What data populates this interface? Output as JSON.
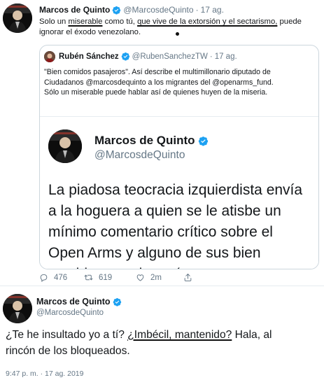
{
  "tweet": {
    "author_name": "Marcos de Quinto",
    "author_handle": "@MarcosdeQuinto",
    "separator": "·",
    "date": "17 ag.",
    "text_line1_a": "Solo un ",
    "text_line1_b": "miserable",
    "text_line1_c": " como tú, ",
    "text_line1_d": "que vive de la extorsión y el sectarismo,",
    "text_line1_e": " puede",
    "text_line2": "ignorar el éxodo venezolano."
  },
  "quoted": {
    "author_name": "Rubén Sánchez",
    "author_handle": "@RubenSanchezTW",
    "separator": "·",
    "date": "17 ag.",
    "lines": [
      "\"Bien comidos pasajeros\". Así describe el multimillonario diputado de",
      "Ciudadanos @marcosdequinto a los migrantes del @openarms_fund.",
      "Sólo un miserable puede hablar así de quienes huyen de la miseria."
    ],
    "image": {
      "author_name": "Marcos de Quinto",
      "author_handle": "@MarcosdeQuinto",
      "lines": [
        "La piadosa teocracia izquierdista envía",
        "a la hoguera a quien se le atisbe un",
        "mínimo comentario crítico sobre el",
        "Open Arms y alguno de sus bien",
        "comidos pasajeros (que costearon su"
      ]
    }
  },
  "actions": {
    "reply_count": "476",
    "retweet_count": "619",
    "like_count": "2m",
    "icons": [
      "reply-icon",
      "retweet-icon",
      "like-icon",
      "share-icon"
    ]
  },
  "reply": {
    "author_name": "Marcos de Quinto",
    "author_handle": "@MarcosdeQuinto",
    "text_line1_a": "¿Te he insultado yo a tí? ",
    "text_line1_b": "¿Imbécil, mantenido?",
    "text_line1_c": " Hala, al",
    "text_line2": "rincón de los bloqueados.",
    "timestamp": "9:47 p. m. · 17 ag. 2019"
  },
  "colors": {
    "verified": "#1da1f2",
    "secondary_text": "#657786",
    "border": "#ccd6dd"
  }
}
